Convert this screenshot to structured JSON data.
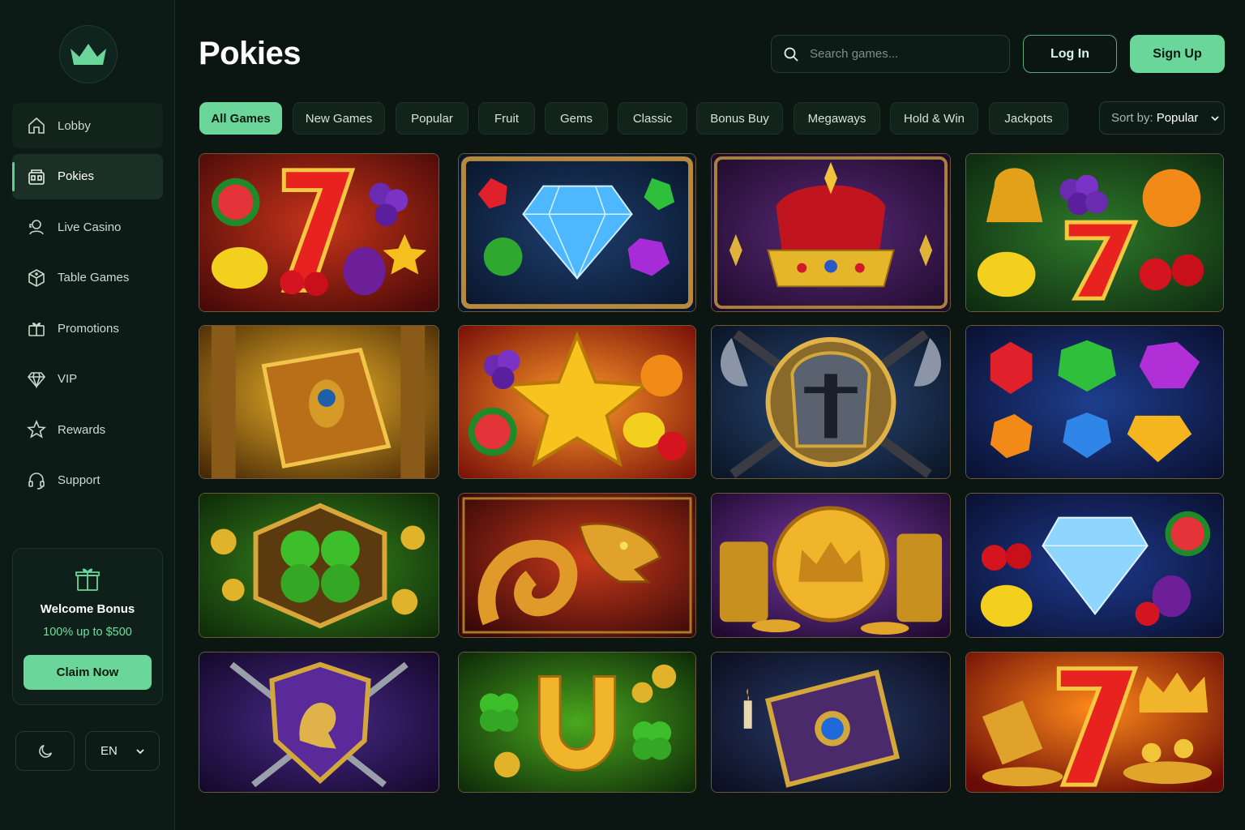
{
  "page": {
    "title": "Pokies"
  },
  "brand": {
    "logo": "crown-icon",
    "accent": "#6bd69a"
  },
  "sidebar": {
    "items": [
      {
        "label": "Lobby",
        "icon": "home-icon"
      },
      {
        "label": "Pokies",
        "icon": "slot-machine-icon",
        "active": true
      },
      {
        "label": "Live Casino",
        "icon": "live-dealer-icon"
      },
      {
        "label": "Table Games",
        "icon": "dice-icon"
      },
      {
        "label": "Promotions",
        "icon": "gift-icon"
      },
      {
        "label": "VIP",
        "icon": "diamond-icon"
      },
      {
        "label": "Rewards",
        "icon": "star-icon"
      },
      {
        "label": "Support",
        "icon": "headset-icon"
      }
    ],
    "bonus": {
      "icon": "gift-icon",
      "title": "Welcome Bonus",
      "subtitle": "100% up to $500",
      "cta": "Claim Now"
    },
    "theme_icon": "moon-icon",
    "language": "EN"
  },
  "header": {
    "search_placeholder": "Search games...",
    "login_label": "Log In",
    "signup_label": "Sign Up"
  },
  "filters": {
    "categories": [
      "All Games",
      "New Games",
      "Popular",
      "Fruit",
      "Gems",
      "Classic",
      "Bonus Buy",
      "Megaways",
      "Hold & Win",
      "Jackpots"
    ],
    "active": "All Games",
    "sort_label": "Sort by:",
    "sort_value": "Popular"
  },
  "games": [
    {
      "art": "fruit-seven-art"
    },
    {
      "art": "diamond-gems-art"
    },
    {
      "art": "royal-crown-art"
    },
    {
      "art": "fruit-bell-seven-art"
    },
    {
      "art": "golden-book-art"
    },
    {
      "art": "star-fruits-art"
    },
    {
      "art": "viking-helmet-art"
    },
    {
      "art": "gem-grid-art"
    },
    {
      "art": "lucky-clover-art"
    },
    {
      "art": "golden-dragon-art"
    },
    {
      "art": "gold-coin-crown-art"
    },
    {
      "art": "diamond-fruits-art"
    },
    {
      "art": "lion-shield-art"
    },
    {
      "art": "horseshoe-clover-art"
    },
    {
      "art": "mystic-book-art"
    },
    {
      "art": "seven-treasure-art"
    }
  ]
}
